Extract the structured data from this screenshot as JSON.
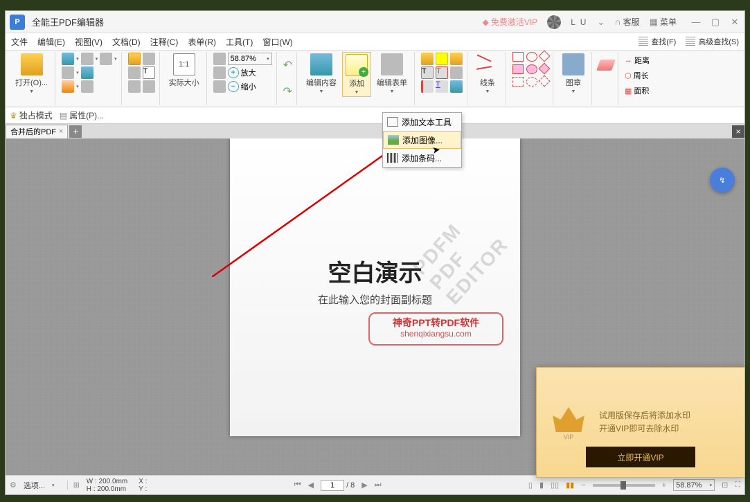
{
  "title": "全能王PDF编辑器",
  "titlebar": {
    "vip": "免费激活VIP",
    "user": "L U",
    "support": "客服",
    "menu": "菜单"
  },
  "menu": {
    "file": "文件",
    "edit": "编辑(E)",
    "view": "视图(V)",
    "doc": "文档(D)",
    "note": "注释(C)",
    "form": "表单(R)",
    "tool": "工具(T)",
    "window": "窗口(W)",
    "find": "查找(F)",
    "adv_find": "高级查找(S)"
  },
  "ribbon": {
    "open": "打开(O)...",
    "actual": "实际大小",
    "zoom_val": "58.87%",
    "zoom_in": "放大",
    "zoom_out": "缩小",
    "edit_content": "编辑内容",
    "add": "添加",
    "edit_form": "编辑表单",
    "lines": "线条",
    "image": "图章",
    "dist": "距离",
    "perim": "周长",
    "area": "面积"
  },
  "secondary": {
    "exclusive": "独占模式",
    "props": "属性(P)..."
  },
  "tab": {
    "name": "合并后的PDF"
  },
  "dropdown": {
    "text": "添加文本工具",
    "image": "添加图像...",
    "barcode": "添加条码..."
  },
  "page": {
    "heading": "空白演示",
    "subtitle": "在此输入您的封面副标题",
    "stamp1": "神奇PPT转PDF软件",
    "stamp_url": "shenqixiangsu.com",
    "watermark": "PDFM PDF EDITOR"
  },
  "vip_popup": {
    "line1": "试用版保存后将添加水印",
    "line2": "开通VIP即可去除水印",
    "btn": "立即开通VIP",
    "vip": "VIP"
  },
  "status": {
    "options": "选项...",
    "w": "W : 200.0mm",
    "h": "H : 200.0mm",
    "x": "X :",
    "y": "Y :",
    "page_cur": "1",
    "page_total": "/ 8",
    "zoom": "58.87%"
  },
  "chart_data": null
}
